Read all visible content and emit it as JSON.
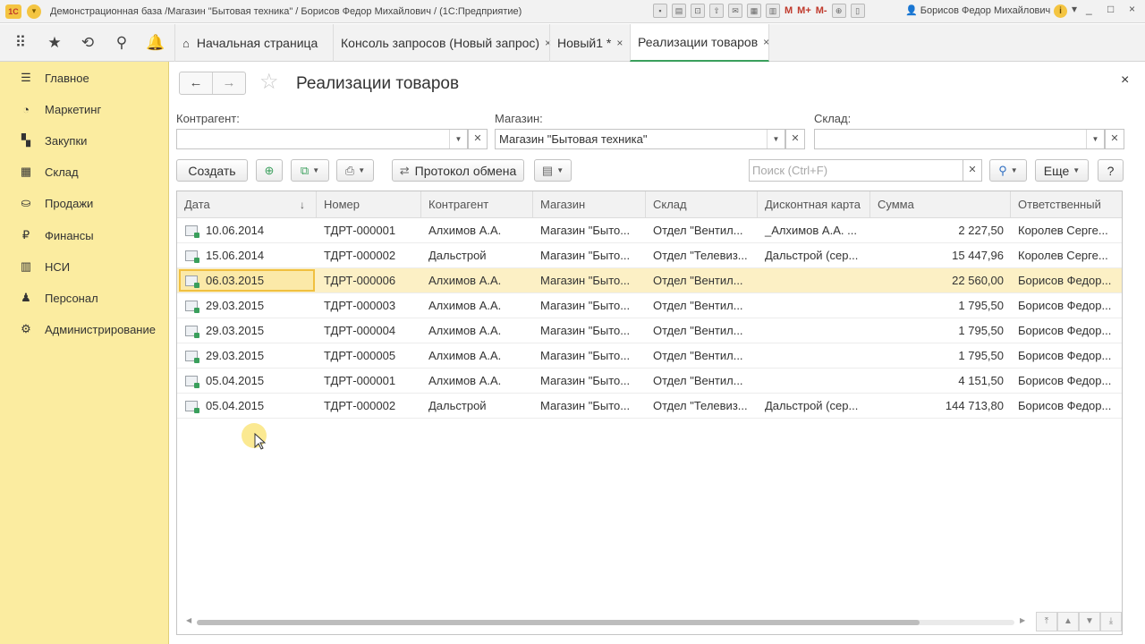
{
  "titlebar": {
    "logo": "1С",
    "title": "Демонстрационная база /Магазин \"Бытовая техника\" / Борисов Федор Михайлович / (1С:Предприятие)",
    "tools": [
      "M",
      "M+",
      "M-"
    ],
    "user": "Борисов Федор Михайлович",
    "info": "i",
    "minimize": "_",
    "maximize": "□",
    "close": "×"
  },
  "nav": {
    "icons": [
      "apps-grid-icon",
      "star-icon",
      "history-icon",
      "search-icon",
      "bell-icon"
    ],
    "tabs": [
      {
        "label": "Начальная страница",
        "close": ""
      },
      {
        "label": "Консоль запросов (Новый запрос)",
        "close": "×"
      },
      {
        "label": "Новый1 *",
        "close": "×"
      },
      {
        "label": "Реализации товаров",
        "close": "×"
      }
    ]
  },
  "sidebar": {
    "items": [
      {
        "label": "Главное",
        "icon": "menu-icon"
      },
      {
        "label": "Маркетинг",
        "icon": "pie-icon"
      },
      {
        "label": "Закупки",
        "icon": "purchases-icon"
      },
      {
        "label": "Склад",
        "icon": "warehouse-icon"
      },
      {
        "label": "Продажи",
        "icon": "basket-icon"
      },
      {
        "label": "Финансы",
        "icon": "ruble-icon"
      },
      {
        "label": "НСИ",
        "icon": "books-icon"
      },
      {
        "label": "Персонал",
        "icon": "person-icon"
      },
      {
        "label": "Администрирование",
        "icon": "gear-icon"
      }
    ]
  },
  "form": {
    "title": "Реализации товаров",
    "close": "×",
    "filters": {
      "kontragent_label": "Контрагент:",
      "kontragent_value": "",
      "magazin_label": "Магазин:",
      "magazin_value": "Магазин \"Бытовая техника\"",
      "sklad_label": "Склад:",
      "sklad_value": ""
    },
    "toolbar": {
      "create": "Создать",
      "exchange": "Протокол обмена",
      "search_placeholder": "Поиск (Ctrl+F)",
      "more": "Еще",
      "help": "?"
    }
  },
  "table": {
    "columns": [
      "Дата",
      "Номер",
      "Контрагент",
      "Магазин",
      "Склад",
      "Дисконтная карта",
      "Сумма",
      "Ответственный"
    ],
    "rows": [
      [
        "10.06.2014",
        "ТДРТ-000001",
        "Алхимов А.А.",
        "Магазин \"Быто...",
        "Отдел \"Вентил...",
        "_Алхимов А.А. ...",
        "2 227,50",
        "Королев Серге..."
      ],
      [
        "15.06.2014",
        "ТДРТ-000002",
        "Дальстрой",
        "Магазин \"Быто...",
        "Отдел \"Телевиз...",
        "Дальстрой (сер...",
        "15 447,96",
        "Королев Серге..."
      ],
      [
        "06.03.2015",
        "ТДРТ-000006",
        "Алхимов А.А.",
        "Магазин \"Быто...",
        "Отдел \"Вентил...",
        "",
        "22 560,00",
        "Борисов Федор..."
      ],
      [
        "29.03.2015",
        "ТДРТ-000003",
        "Алхимов А.А.",
        "Магазин \"Быто...",
        "Отдел \"Вентил...",
        "",
        "1 795,50",
        "Борисов Федор..."
      ],
      [
        "29.03.2015",
        "ТДРТ-000004",
        "Алхимов А.А.",
        "Магазин \"Быто...",
        "Отдел \"Вентил...",
        "",
        "1 795,50",
        "Борисов Федор..."
      ],
      [
        "29.03.2015",
        "ТДРТ-000005",
        "Алхимов А.А.",
        "Магазин \"Быто...",
        "Отдел \"Вентил...",
        "",
        "1 795,50",
        "Борисов Федор..."
      ],
      [
        "05.04.2015",
        "ТДРТ-000001",
        "Алхимов А.А.",
        "Магазин \"Быто...",
        "Отдел \"Вентил...",
        "",
        "4 151,50",
        "Борисов Федор..."
      ],
      [
        "05.04.2015",
        "ТДРТ-000002",
        "Дальстрой",
        "Магазин \"Быто...",
        "Отдел \"Телевиз...",
        "Дальстрой (сер...",
        "144 713,80",
        "Борисов Федор..."
      ]
    ],
    "selected_row": 2
  },
  "colors": {
    "sidebar_bg": "#fbeca0",
    "accent_green": "#3a9f5c",
    "selection": "#fcf0c5"
  }
}
